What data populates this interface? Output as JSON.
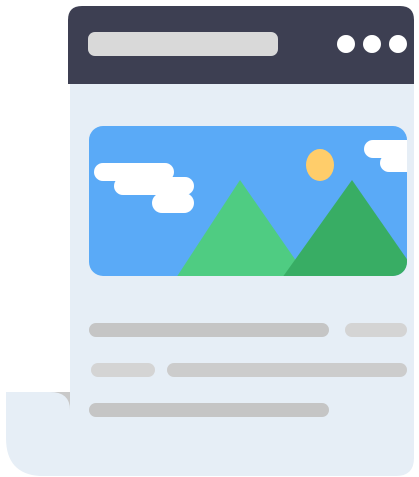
{
  "illustration": {
    "subject": "web-page-document-icon",
    "icons": {
      "menu": "more-dots-icon",
      "image": "landscape-image-icon",
      "sun": "sun-icon",
      "cloud": "cloud-icon",
      "mountain": "mountain-icon",
      "page_curl": "page-curl-icon"
    },
    "colors": {
      "header": "#3d3f52",
      "paper": "#e6eef6",
      "paper_curl": "#c9c9c9",
      "address_bar": "#d9d9d9",
      "menu_dots": "#ffffff",
      "sky": "#5aaaf7",
      "cloud": "#ffffff",
      "sun": "#ffcd6a",
      "mountain_light": "#4fcc82",
      "mountain_dark": "#38ad64",
      "text_line": "#c5c5c5"
    }
  }
}
